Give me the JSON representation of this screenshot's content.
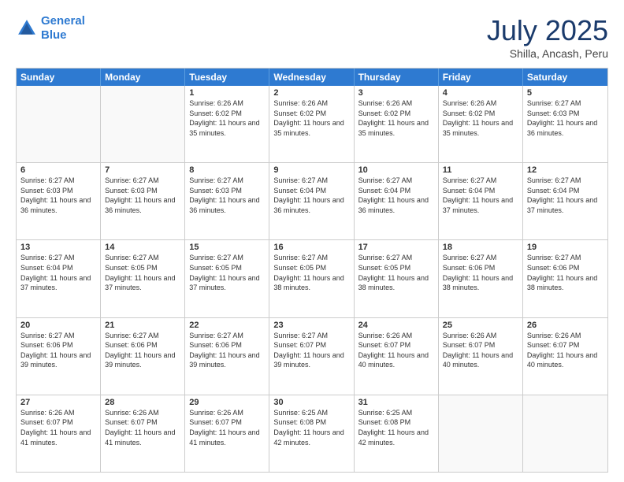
{
  "header": {
    "logo_line1": "General",
    "logo_line2": "Blue",
    "month": "July 2025",
    "location": "Shilla, Ancash, Peru"
  },
  "days_of_week": [
    "Sunday",
    "Monday",
    "Tuesday",
    "Wednesday",
    "Thursday",
    "Friday",
    "Saturday"
  ],
  "weeks": [
    [
      {
        "day": "",
        "empty": true
      },
      {
        "day": "",
        "empty": true
      },
      {
        "day": "1",
        "sunrise": "Sunrise: 6:26 AM",
        "sunset": "Sunset: 6:02 PM",
        "daylight": "Daylight: 11 hours and 35 minutes."
      },
      {
        "day": "2",
        "sunrise": "Sunrise: 6:26 AM",
        "sunset": "Sunset: 6:02 PM",
        "daylight": "Daylight: 11 hours and 35 minutes."
      },
      {
        "day": "3",
        "sunrise": "Sunrise: 6:26 AM",
        "sunset": "Sunset: 6:02 PM",
        "daylight": "Daylight: 11 hours and 35 minutes."
      },
      {
        "day": "4",
        "sunrise": "Sunrise: 6:26 AM",
        "sunset": "Sunset: 6:02 PM",
        "daylight": "Daylight: 11 hours and 35 minutes."
      },
      {
        "day": "5",
        "sunrise": "Sunrise: 6:27 AM",
        "sunset": "Sunset: 6:03 PM",
        "daylight": "Daylight: 11 hours and 36 minutes."
      }
    ],
    [
      {
        "day": "6",
        "sunrise": "Sunrise: 6:27 AM",
        "sunset": "Sunset: 6:03 PM",
        "daylight": "Daylight: 11 hours and 36 minutes."
      },
      {
        "day": "7",
        "sunrise": "Sunrise: 6:27 AM",
        "sunset": "Sunset: 6:03 PM",
        "daylight": "Daylight: 11 hours and 36 minutes."
      },
      {
        "day": "8",
        "sunrise": "Sunrise: 6:27 AM",
        "sunset": "Sunset: 6:03 PM",
        "daylight": "Daylight: 11 hours and 36 minutes."
      },
      {
        "day": "9",
        "sunrise": "Sunrise: 6:27 AM",
        "sunset": "Sunset: 6:04 PM",
        "daylight": "Daylight: 11 hours and 36 minutes."
      },
      {
        "day": "10",
        "sunrise": "Sunrise: 6:27 AM",
        "sunset": "Sunset: 6:04 PM",
        "daylight": "Daylight: 11 hours and 36 minutes."
      },
      {
        "day": "11",
        "sunrise": "Sunrise: 6:27 AM",
        "sunset": "Sunset: 6:04 PM",
        "daylight": "Daylight: 11 hours and 37 minutes."
      },
      {
        "day": "12",
        "sunrise": "Sunrise: 6:27 AM",
        "sunset": "Sunset: 6:04 PM",
        "daylight": "Daylight: 11 hours and 37 minutes."
      }
    ],
    [
      {
        "day": "13",
        "sunrise": "Sunrise: 6:27 AM",
        "sunset": "Sunset: 6:04 PM",
        "daylight": "Daylight: 11 hours and 37 minutes."
      },
      {
        "day": "14",
        "sunrise": "Sunrise: 6:27 AM",
        "sunset": "Sunset: 6:05 PM",
        "daylight": "Daylight: 11 hours and 37 minutes."
      },
      {
        "day": "15",
        "sunrise": "Sunrise: 6:27 AM",
        "sunset": "Sunset: 6:05 PM",
        "daylight": "Daylight: 11 hours and 37 minutes."
      },
      {
        "day": "16",
        "sunrise": "Sunrise: 6:27 AM",
        "sunset": "Sunset: 6:05 PM",
        "daylight": "Daylight: 11 hours and 38 minutes."
      },
      {
        "day": "17",
        "sunrise": "Sunrise: 6:27 AM",
        "sunset": "Sunset: 6:05 PM",
        "daylight": "Daylight: 11 hours and 38 minutes."
      },
      {
        "day": "18",
        "sunrise": "Sunrise: 6:27 AM",
        "sunset": "Sunset: 6:06 PM",
        "daylight": "Daylight: 11 hours and 38 minutes."
      },
      {
        "day": "19",
        "sunrise": "Sunrise: 6:27 AM",
        "sunset": "Sunset: 6:06 PM",
        "daylight": "Daylight: 11 hours and 38 minutes."
      }
    ],
    [
      {
        "day": "20",
        "sunrise": "Sunrise: 6:27 AM",
        "sunset": "Sunset: 6:06 PM",
        "daylight": "Daylight: 11 hours and 39 minutes."
      },
      {
        "day": "21",
        "sunrise": "Sunrise: 6:27 AM",
        "sunset": "Sunset: 6:06 PM",
        "daylight": "Daylight: 11 hours and 39 minutes."
      },
      {
        "day": "22",
        "sunrise": "Sunrise: 6:27 AM",
        "sunset": "Sunset: 6:06 PM",
        "daylight": "Daylight: 11 hours and 39 minutes."
      },
      {
        "day": "23",
        "sunrise": "Sunrise: 6:27 AM",
        "sunset": "Sunset: 6:07 PM",
        "daylight": "Daylight: 11 hours and 39 minutes."
      },
      {
        "day": "24",
        "sunrise": "Sunrise: 6:26 AM",
        "sunset": "Sunset: 6:07 PM",
        "daylight": "Daylight: 11 hours and 40 minutes."
      },
      {
        "day": "25",
        "sunrise": "Sunrise: 6:26 AM",
        "sunset": "Sunset: 6:07 PM",
        "daylight": "Daylight: 11 hours and 40 minutes."
      },
      {
        "day": "26",
        "sunrise": "Sunrise: 6:26 AM",
        "sunset": "Sunset: 6:07 PM",
        "daylight": "Daylight: 11 hours and 40 minutes."
      }
    ],
    [
      {
        "day": "27",
        "sunrise": "Sunrise: 6:26 AM",
        "sunset": "Sunset: 6:07 PM",
        "daylight": "Daylight: 11 hours and 41 minutes."
      },
      {
        "day": "28",
        "sunrise": "Sunrise: 6:26 AM",
        "sunset": "Sunset: 6:07 PM",
        "daylight": "Daylight: 11 hours and 41 minutes."
      },
      {
        "day": "29",
        "sunrise": "Sunrise: 6:26 AM",
        "sunset": "Sunset: 6:07 PM",
        "daylight": "Daylight: 11 hours and 41 minutes."
      },
      {
        "day": "30",
        "sunrise": "Sunrise: 6:25 AM",
        "sunset": "Sunset: 6:08 PM",
        "daylight": "Daylight: 11 hours and 42 minutes."
      },
      {
        "day": "31",
        "sunrise": "Sunrise: 6:25 AM",
        "sunset": "Sunset: 6:08 PM",
        "daylight": "Daylight: 11 hours and 42 minutes."
      },
      {
        "day": "",
        "empty": true
      },
      {
        "day": "",
        "empty": true
      }
    ]
  ]
}
